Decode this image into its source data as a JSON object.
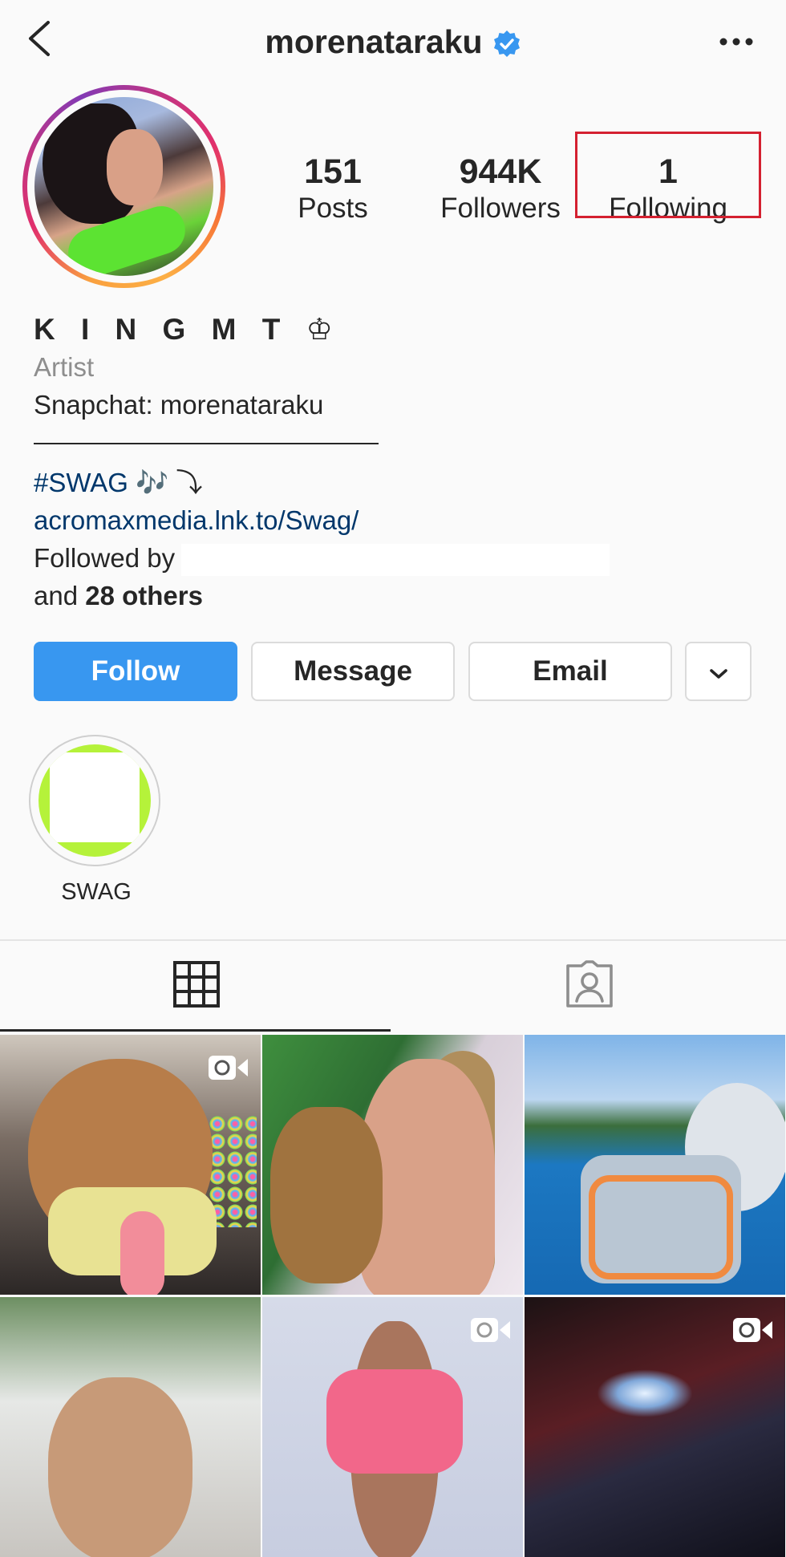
{
  "header": {
    "username": "morenataraku",
    "back_icon": "chevron-left-icon",
    "verified_icon": "verified-badge-icon",
    "verified_color": "#3897f0",
    "more_icon": "more-horizontal-icon"
  },
  "profile": {
    "avatar_icon": "profile-avatar",
    "stats": {
      "posts": {
        "value": "151",
        "label": "Posts"
      },
      "followers": {
        "value": "944K",
        "label": "Followers"
      },
      "following": {
        "value": "1",
        "label": "Following"
      }
    },
    "highlight_box_color": "#d42030"
  },
  "bio": {
    "display_name": "K I N G  M T ♔",
    "category": "Artist",
    "snapchat": "Snapchat:  morenataraku",
    "hashtag": "#SWAG",
    "hashtag_suffix": " 🎶  ⤵",
    "link": "acromaxmedia.lnk.to/Swag/",
    "followed_by_prefix": "Followed by",
    "and_text": "and",
    "others_text": "28 others"
  },
  "actions": {
    "follow": "Follow",
    "message": "Message",
    "email": "Email",
    "more_icon": "chevron-down-icon",
    "follow_color": "#3897f0"
  },
  "highlights": [
    {
      "label": "SWAG"
    }
  ],
  "tabs": {
    "grid_icon": "grid-icon",
    "tagged_icon": "tagged-person-icon"
  },
  "posts": [
    {
      "kind": "video",
      "icon": "video-camera-icon"
    },
    {
      "kind": "photo"
    },
    {
      "kind": "photo"
    },
    {
      "kind": "photo"
    },
    {
      "kind": "video",
      "icon": "video-camera-icon"
    },
    {
      "kind": "video",
      "icon": "video-camera-icon"
    }
  ]
}
